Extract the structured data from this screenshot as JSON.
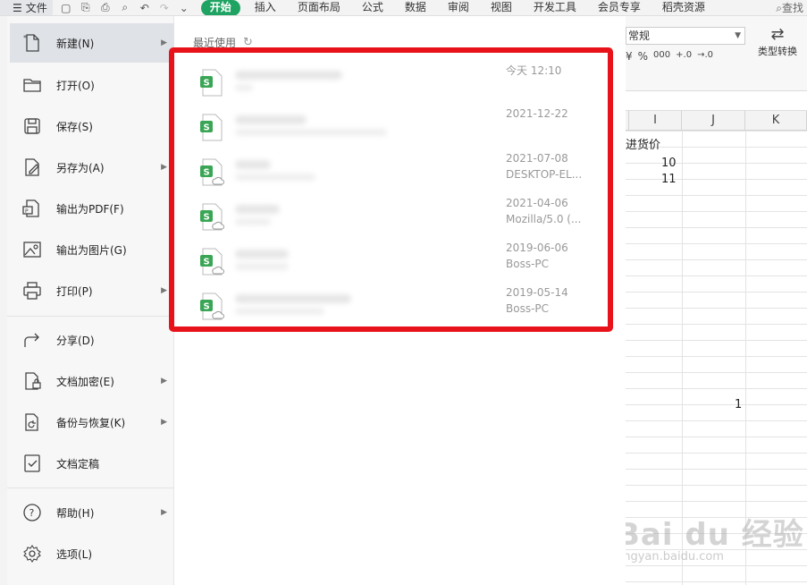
{
  "topbar": {
    "file_label": "文件",
    "tabs": [
      "开始",
      "插入",
      "页面布局",
      "公式",
      "数据",
      "审阅",
      "视图",
      "开发工具",
      "会员专享",
      "稻壳资源"
    ],
    "search_label": "查找"
  },
  "ribbon": {
    "number_format": "常规",
    "num_icons": [
      "¥",
      "%",
      "000",
      "+.0",
      "→.0"
    ],
    "convert_label": "类型转换"
  },
  "sheet": {
    "columns": [
      "I",
      "J",
      "K"
    ],
    "header_fragment": "进货价",
    "values": [
      "10",
      "11",
      "1"
    ]
  },
  "menu": {
    "items": [
      {
        "label": "新建(N)",
        "icon": "new-file-icon",
        "submenu": true
      },
      {
        "label": "打开(O)",
        "icon": "folder-icon",
        "submenu": false
      },
      {
        "label": "保存(S)",
        "icon": "save-icon",
        "submenu": false
      },
      {
        "label": "另存为(A)",
        "icon": "save-as-icon",
        "submenu": true
      },
      {
        "label": "输出为PDF(F)",
        "icon": "pdf-icon",
        "submenu": false
      },
      {
        "label": "输出为图片(G)",
        "icon": "image-icon",
        "submenu": false
      },
      {
        "label": "打印(P)",
        "icon": "printer-icon",
        "submenu": true
      },
      {
        "label": "分享(D)",
        "icon": "share-icon",
        "submenu": false
      },
      {
        "label": "文档加密(E)",
        "icon": "lock-doc-icon",
        "submenu": true
      },
      {
        "label": "备份与恢复(K)",
        "icon": "backup-icon",
        "submenu": true
      },
      {
        "label": "文档定稿",
        "icon": "finalize-icon",
        "submenu": false
      },
      {
        "label": "帮助(H)",
        "icon": "help-icon",
        "submenu": true
      },
      {
        "label": "选项(L)",
        "icon": "settings-icon",
        "submenu": false
      }
    ]
  },
  "recent": {
    "title": "最近使用",
    "files": [
      {
        "date": "今天  12:10",
        "source": ""
      },
      {
        "date": "2021-12-22",
        "source": ""
      },
      {
        "date": "2021-07-08",
        "source": "DESKTOP-EL..."
      },
      {
        "date": "2021-04-06",
        "source": "Mozilla/5.0 (..."
      },
      {
        "date": "2019-06-06",
        "source": "Boss-PC"
      },
      {
        "date": "2019-05-14",
        "source": "Boss-PC"
      }
    ]
  },
  "watermark": {
    "main": "Bai du 经验",
    "sub": "jingyan.baidu.com"
  },
  "colors": {
    "accent": "#1ea362",
    "highlight": "#e8131a",
    "sheet_icon": "#3aa655"
  }
}
